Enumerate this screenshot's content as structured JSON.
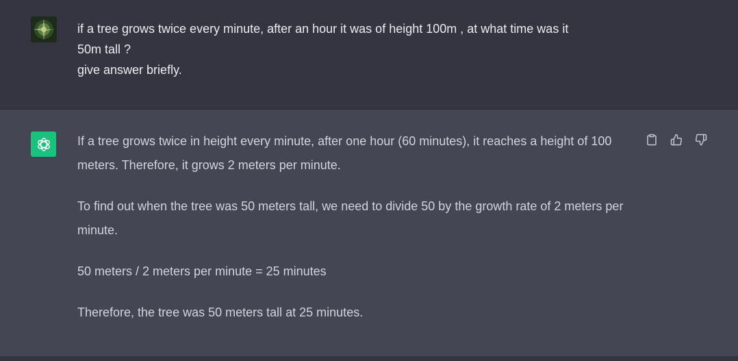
{
  "conversation": {
    "user_message": {
      "lines": [
        "if a tree grows twice every minute, after an hour it was of height 100m , at what time was it",
        "50m tall ?",
        "give answer briefly."
      ]
    },
    "assistant_message": {
      "paragraphs": [
        "If a tree grows twice in height every minute, after one hour (60 minutes), it reaches a height of 100 meters. Therefore, it grows 2 meters per minute.",
        "To find out when the tree was 50 meters tall, we need to divide 50 by the growth rate of 2 meters per minute.",
        "50 meters / 2 meters per minute = 25 minutes",
        "Therefore, the tree was 50 meters tall at 25 minutes."
      ]
    }
  },
  "actions": {
    "icons": [
      "clipboard-icon",
      "thumbs-up-icon",
      "thumbs-down-icon"
    ]
  },
  "colors": {
    "user_background": "#343541",
    "assistant_background": "#444654",
    "assistant_avatar": "#19c37d",
    "user_text": "#ececf1",
    "assistant_text": "#d1d5db"
  }
}
